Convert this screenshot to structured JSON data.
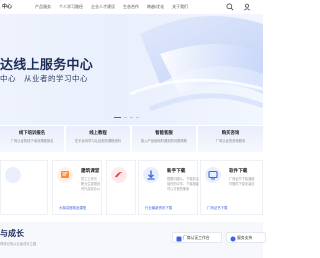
{
  "nav": {
    "logo": "中心",
    "menu": [
      "产品服务",
      "个人学习路径",
      "企业人才建设",
      "生态合作",
      "跨越/优化",
      "关于我们"
    ],
    "icons": [
      "search-icon",
      "user-icon"
    ]
  },
  "hero": {
    "title": "达线上服务中心",
    "subtitle": "中心　从业者的学习中心",
    "slides": 4,
    "active_slide": 1
  },
  "quick_links": [
    {
      "title": "线下培训报名",
      "desc": "厂商认证的线下培训课程报名"
    },
    {
      "title": "线上教程",
      "desc": "在平台内学习认证相关课程资料"
    },
    {
      "title": "智能客服",
      "desc": "接入产品使用时遇到的问题帮助"
    },
    {
      "title": "购买咨询",
      "desc": "厂商认证的咨询服务"
    }
  ],
  "services": [
    {
      "title": "",
      "desc": [
        "",
        "",
        ""
      ],
      "link": "",
      "color": "#3a64e0"
    },
    {
      "title": "建筑课堂",
      "desc": [
        "员工工作坊",
        "职业生涯规划",
        "时代高效办公"
      ],
      "link": "大咖讲座精品课堂",
      "color": "#ff8a3d"
    },
    {
      "title": "",
      "desc": [
        "",
        "",
        ""
      ],
      "link": "",
      "color": "#e84545"
    },
    {
      "title": "新手下载",
      "desc": [
        "根据问题从，下载前沿",
        "操作的中华，下载超级",
        "可以方便的使用"
      ],
      "link": "行业最新资讯下载",
      "color": "#3a64e0"
    },
    {
      "title": "软件下载",
      "desc": [
        "厂商证书下载通道",
        "可随时下载安装包",
        ""
      ],
      "link": "厂商证书下载",
      "color": "#3a64e0"
    }
  ],
  "growth": {
    "title": "与成长",
    "subtitle": "得成长的从业者成长之路",
    "buttons": [
      {
        "label": "厂商认证工作台",
        "icon": "workbench-icon"
      },
      {
        "label": "服务支持",
        "icon": "support-icon"
      }
    ]
  },
  "colors": {
    "accent": "#3a64e0",
    "title": "#1f2d5a",
    "hero_bg": "#eef3fd"
  }
}
